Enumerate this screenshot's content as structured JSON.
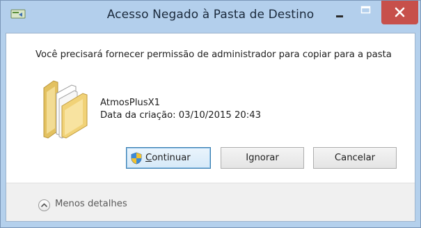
{
  "window": {
    "title": "Acesso Negado à Pasta de Destino",
    "colors": {
      "frame": "#b3cfec",
      "close_button": "#c7504b",
      "primary_button_border": "#3c7fb1"
    }
  },
  "titlebar": {
    "icons": [
      "app-icon",
      "minimize-icon",
      "maximize-icon",
      "close-icon"
    ]
  },
  "message": {
    "text": "Você precisará fornecer permissão de administrador para copiar para a pasta"
  },
  "item": {
    "icon": "folder-icon",
    "name": "AtmosPlusX1",
    "date": "Data da criação: 03/10/2015 20:43"
  },
  "buttons": {
    "continue_label": "Continuar",
    "ignore_label": "Ignorar",
    "cancel_label": "Cancelar"
  },
  "footer": {
    "details_label": "Menos detalhes"
  }
}
